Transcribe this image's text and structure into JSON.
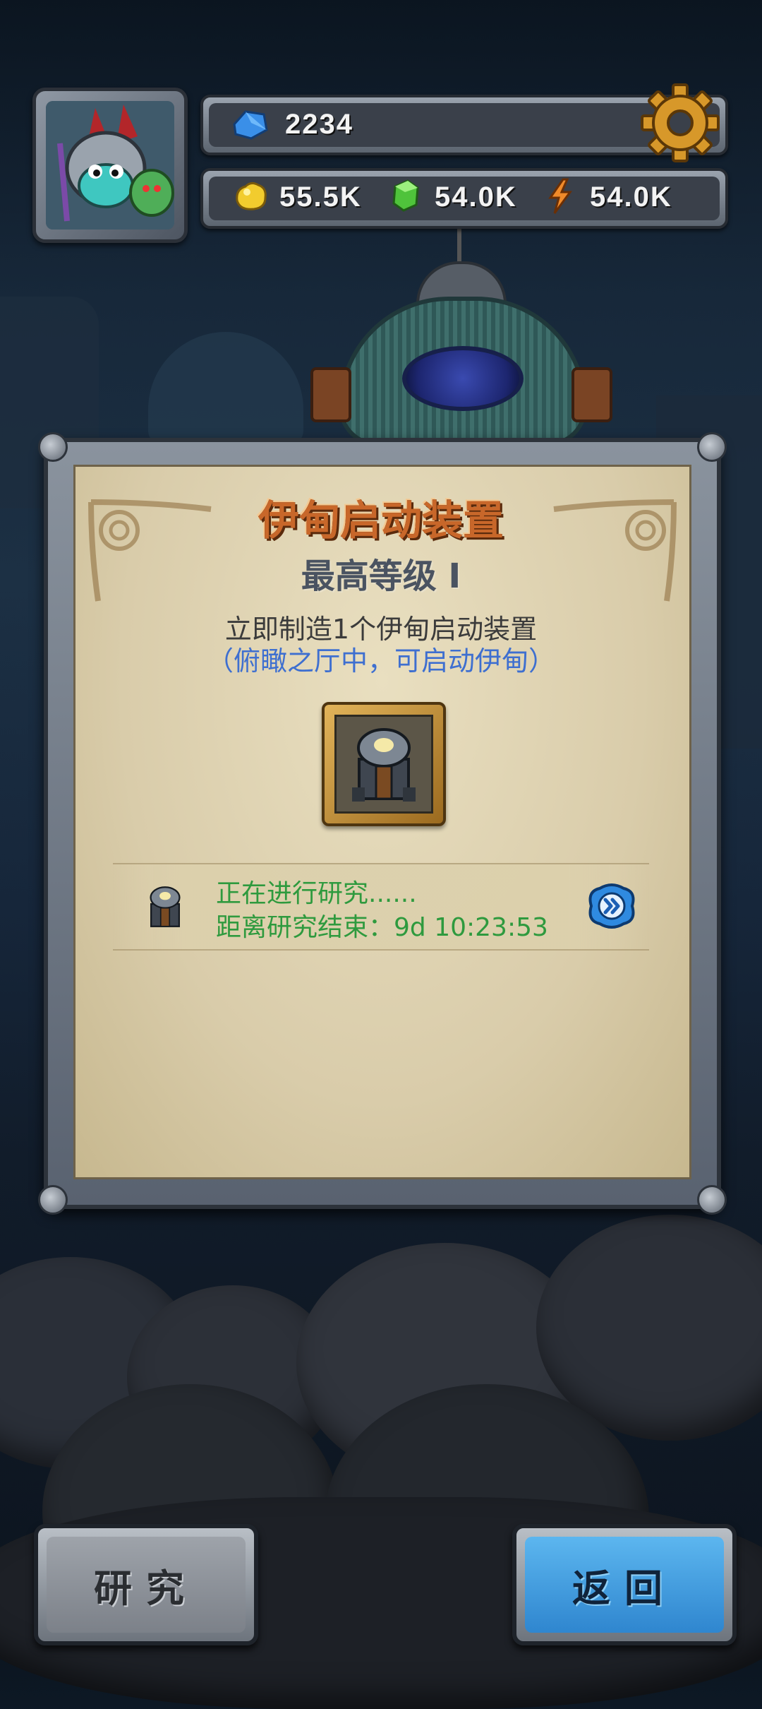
{
  "hud": {
    "gems": "2234",
    "gold": "55.5K",
    "stone": "54.0K",
    "energy": "54.0K"
  },
  "panel": {
    "title": "伊甸启动装置",
    "level": "最高等级 I",
    "description": "立即制造1个伊甸启动装置",
    "note": "（俯瞰之厅中，可启动伊甸）"
  },
  "progress": {
    "status": "正在进行研究......",
    "remaining": "距离研究结束：9d 10:23:53"
  },
  "buttons": {
    "research": "研究",
    "back": "返回"
  },
  "colors": {
    "title": "#c8672a",
    "progress_text": "#2e9a3e",
    "note": "#3e6fd0",
    "back_button": "#3c9ae0"
  }
}
